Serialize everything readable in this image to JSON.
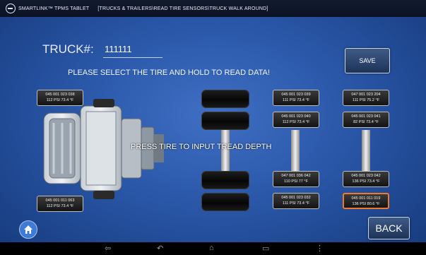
{
  "titlebar": {
    "app_name": "SMARTLINK™ TPMS TABLET",
    "breadcrumb": "[TRUCKS & TRAILERS\\READ TIRE SENSORS\\TRUCK WALK AROUND]"
  },
  "truck": {
    "label": "TRUCK#:",
    "number": "111111"
  },
  "instruction": "PLEASE SELECT THE TIRE AND HOLD TO READ DATA!",
  "press_note": "PRESS TIRE TO INPUT TREAD DEPTH",
  "buttons": {
    "save": "SAVE",
    "back": "BACK"
  },
  "sensors": [
    {
      "id": "045 001 023 038",
      "reading": "112 PSI 73.4 °F",
      "selected": false
    },
    {
      "id": "045 001 011 063",
      "reading": "112 PSI 73.4 °F",
      "selected": false
    },
    {
      "id": "045 001 023 039",
      "reading": "111 PSI 73.4 °F",
      "selected": false
    },
    {
      "id": "045 001 023 040",
      "reading": "112 PSI 73.4 °F",
      "selected": false
    },
    {
      "id": "047 001 036 042",
      "reading": "110 PSI 77 °F",
      "selected": false
    },
    {
      "id": "045 001 023 032",
      "reading": "111 PSI 73.4 °F",
      "selected": false
    },
    {
      "id": "047 001 023 204",
      "reading": "111 PSI 75.2 °F",
      "selected": false
    },
    {
      "id": "045 001 023 041",
      "reading": "82 PSI 73.4 °F",
      "selected": false
    },
    {
      "id": "045 001 023 042",
      "reading": "136 PSI 73.4 °F",
      "selected": false
    },
    {
      "id": "045 001 011 019",
      "reading": "136 PSI 80.6 °F",
      "selected": true
    }
  ],
  "colors": {
    "background": "#2a57a8",
    "selected_border": "#f07a2a",
    "home_button": "#3d7bd6"
  },
  "icons": [
    "home-icon",
    "nav-back-icon",
    "nav-home-icon",
    "nav-recents-icon",
    "nav-menu-icon",
    "app-logo-icon"
  ]
}
